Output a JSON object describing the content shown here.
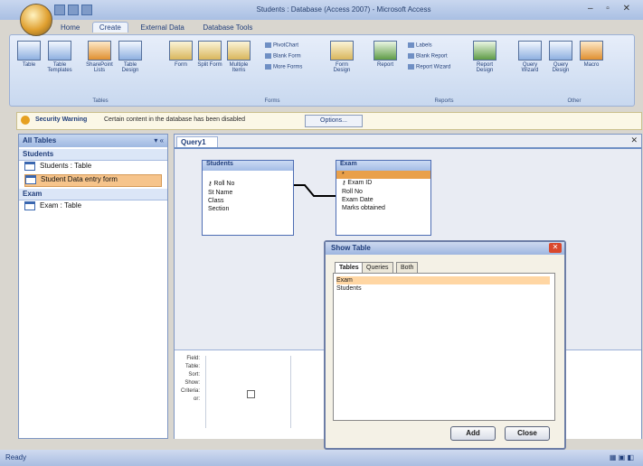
{
  "window": {
    "title": "Students : Database (Access 2007) - Microsoft Access",
    "controls": "– ▫ ✕"
  },
  "ribbon": {
    "tabs": [
      "Home",
      "Create",
      "External Data",
      "Database Tools"
    ],
    "active_tab": "Create",
    "buttons": [
      {
        "label": "Table",
        "icon": "table-icon"
      },
      {
        "label": "Table Templates",
        "icon": "table-templates-icon"
      },
      {
        "label": "SharePoint Lists",
        "icon": "sharepoint-icon"
      },
      {
        "label": "Table Design",
        "icon": "table-design-icon"
      },
      {
        "label": "Form",
        "icon": "form-icon"
      },
      {
        "label": "Split Form",
        "icon": "split-form-icon"
      },
      {
        "label": "Multiple Items",
        "icon": "multiple-items-icon"
      },
      {
        "label": "Form Design",
        "icon": "form-design-icon"
      },
      {
        "label": "Report",
        "icon": "report-icon"
      },
      {
        "label": "Report Design",
        "icon": "report-design-icon"
      },
      {
        "label": "Query Wizard",
        "icon": "query-wizard-icon"
      },
      {
        "label": "Query Design",
        "icon": "query-design-icon"
      },
      {
        "label": "Macro",
        "icon": "macro-icon"
      }
    ],
    "small_buttons": [
      "PivotChart",
      "Blank Form",
      "More Forms",
      "Labels",
      "Blank Report",
      "Report Wizard"
    ],
    "groups": [
      "Tables",
      "Forms",
      "Reports",
      "Other"
    ]
  },
  "security": {
    "title": "Security Warning",
    "message": "Certain content in the database has been disabled",
    "options_label": "Options..."
  },
  "nav": {
    "header": "All Tables",
    "groups": [
      {
        "name": "Students",
        "items": [
          "Students : Table",
          "Student Data entry form"
        ]
      },
      {
        "name": "Exam",
        "items": [
          "Exam : Table"
        ]
      }
    ],
    "selected_item": "Student Data entry form"
  },
  "query": {
    "tab_label": "Query1",
    "tables": [
      {
        "name": "Students",
        "fields": [
          "Roll No",
          "St Name",
          "Class",
          "Section"
        ],
        "key_field": "Roll No"
      },
      {
        "name": "Exam",
        "fields": [
          "*",
          "Exam ID",
          "Roll No",
          "Exam Date",
          "Marks obtained"
        ],
        "key_field": "Exam ID"
      }
    ],
    "grid_labels": [
      "Field:",
      "Table:",
      "Sort:",
      "Show:",
      "Criteria:",
      "or:"
    ]
  },
  "dialog": {
    "title": "Show Table",
    "tabs": [
      "Tables",
      "Queries",
      "Both"
    ],
    "active_tab": "Tables",
    "items": [
      "Exam",
      "Students"
    ],
    "selected": "Exam",
    "add_label": "Add",
    "close_label": "Close"
  },
  "status": {
    "text": "Ready"
  }
}
